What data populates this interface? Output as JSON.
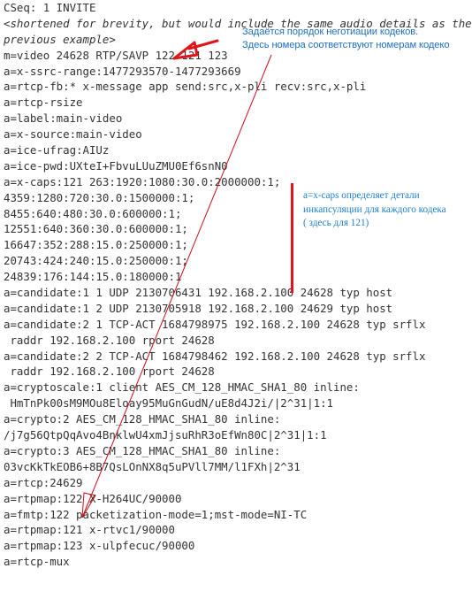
{
  "document": {
    "lines": [
      {
        "text": "CSeq: 1 INVITE",
        "style": "normal"
      },
      {
        "text": "<shortened for brevity, but would include the same audio details as the",
        "style": "italic"
      },
      {
        "text": "previous example>",
        "style": "italic"
      },
      {
        "text": "m=video 24628 RTP/SAVP 122 121 123",
        "style": "normal"
      },
      {
        "text": "a=x-ssrc-range:1477293570-1477293669",
        "style": "normal"
      },
      {
        "text": "a=rtcp-fb:* x-message app send:src,x-pli recv:src,x-pli",
        "style": "normal"
      },
      {
        "text": "a=rtcp-rsize",
        "style": "normal"
      },
      {
        "text": "a=label:main-video",
        "style": "normal"
      },
      {
        "text": "a=x-source:main-video",
        "style": "normal"
      },
      {
        "text": "a=ice-ufrag:AIUz",
        "style": "normal"
      },
      {
        "text": "a=ice-pwd:UXteI+FbvuLUuZMU0Ef6snN0",
        "style": "normal"
      },
      {
        "text": "a=x-caps:121 263:1920:1080:30.0:2000000:1;",
        "style": "normal"
      },
      {
        "text": "4359:1280:720:30.0:1500000:1;",
        "style": "normal"
      },
      {
        "text": "8455:640:480:30.0:600000:1;",
        "style": "normal"
      },
      {
        "text": "12551:640:360:30.0:600000:1;",
        "style": "normal"
      },
      {
        "text": "16647:352:288:15.0:250000:1;",
        "style": "normal"
      },
      {
        "text": "20743:424:240:15.0:250000:1;",
        "style": "normal"
      },
      {
        "text": "24839:176:144:15.0:180000:1",
        "style": "normal"
      },
      {
        "text": "a=candidate:1 1 UDP 2130706431 192.168.2.100 24628 typ host",
        "style": "normal"
      },
      {
        "text": "a=candidate:1 2 UDP 2130705918 192.168.2.100 24629 typ host",
        "style": "normal"
      },
      {
        "text": "a=candidate:2 1 TCP-ACT 1684798975 192.168.2.100 24628 typ srflx",
        "style": "normal"
      },
      {
        "text": " raddr 192.168.2.100 rport 24628",
        "style": "normal"
      },
      {
        "text": "a=candidate:2 2 TCP-ACT 1684798462 192.168.2.100 24628 typ srflx",
        "style": "normal"
      },
      {
        "text": " raddr 192.168.2.100 rport 24628",
        "style": "normal"
      },
      {
        "text": "a=cryptoscale:1 client AES_CM_128_HMAC_SHA1_80 inline:",
        "style": "normal"
      },
      {
        "text": " HmTnPk00sM9MOu8Eloay95MuGnGudN/uE8d4J2i/|2^31|1:1",
        "style": "normal"
      },
      {
        "text": "a=crypto:2 AES_CM_128_HMAC_SHA1_80 inline:",
        "style": "normal"
      },
      {
        "text": "/j7g56QtpQqAvo4BnklwU4xmJjsuRhR3oEfWn80C|2^31|1:1",
        "style": "normal"
      },
      {
        "text": "a=crypto:3 AES_CM_128_HMAC_SHA1_80 inline:",
        "style": "normal"
      },
      {
        "text": "03vcKkTkEOB6+8B7QsLOnNX8q5uPVll7MM/l1FXh|2^31",
        "style": "normal"
      },
      {
        "text": "a=rtcp:24629",
        "style": "normal"
      },
      {
        "text": "a=rtpmap:122 X-H264UC/90000",
        "style": "normal"
      },
      {
        "text": "a=fmtp:122 packetization-mode=1;mst-mode=NI-TC",
        "style": "normal"
      },
      {
        "text": "a=rtpmap:121 x-rtvc1/90000",
        "style": "normal"
      },
      {
        "text": "a=rtpmap:123 x-ulpfecuc/90000",
        "style": "normal"
      },
      {
        "text": "a=rtcp-mux",
        "style": "normal"
      }
    ]
  },
  "annotations": {
    "codec_order_note": {
      "line1": "Задаётся порядок неготиации кодеков.",
      "line2": "Здесь номера соответствуют номерам кодеко"
    },
    "xcaps_note": {
      "text": "a=x-caps определяет детали инкапсуляции для каждого кодека ( здесь для 121)"
    },
    "colors": {
      "arrow": "#e0141a",
      "connector_line": "#c8101a",
      "note_text": "#1f6fbf",
      "code_text": "#333333"
    }
  }
}
